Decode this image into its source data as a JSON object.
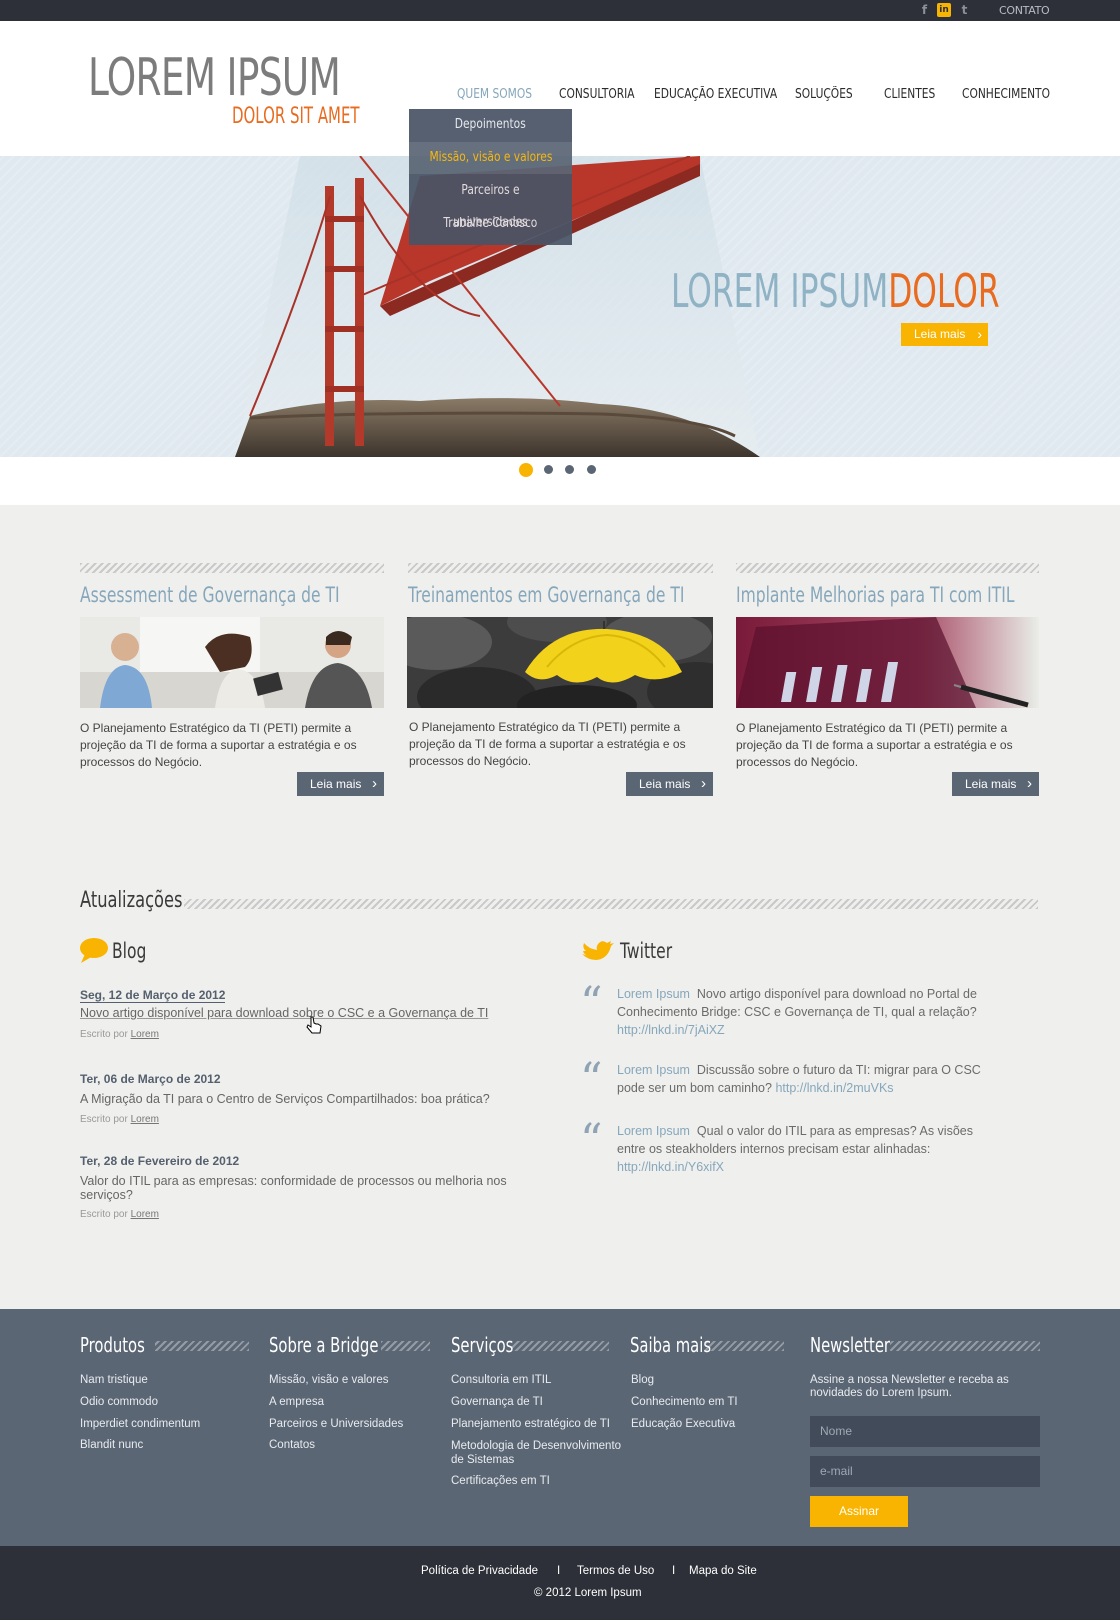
{
  "topbar": {
    "social": [
      {
        "icon": "facebook-icon",
        "glyph": "f"
      },
      {
        "icon": "linkedin-icon",
        "glyph": "in"
      },
      {
        "icon": "twitter-icon",
        "glyph": "t"
      }
    ],
    "contact_label": "CONTATO"
  },
  "logo": {
    "main": "LOREM IPSUM",
    "sub": "DOLOR SIT AMET"
  },
  "nav": {
    "items": [
      "QUEM SOMOS",
      "CONSULTORIA",
      "EDUCAÇÃO EXECUTIVA",
      "SOLUÇÕES",
      "CLIENTES",
      "CONHECIMENTO"
    ],
    "active_index": 0,
    "dropdown": [
      "Depoimentos",
      "Missão, visão e valores",
      "Parceiros e universidades",
      "Trabalhe Conosco"
    ],
    "dropdown_highlight_index": 1
  },
  "hero": {
    "title_part1": "LOREM IPSUM",
    "title_part2": "DOLOR",
    "button_label": "Leia mais",
    "slides": 4,
    "active_slide": 0
  },
  "features": [
    {
      "title": "Assessment de Governança de TI",
      "image": "business-meeting-photo",
      "text": "O Planejamento Estratégico da TI (PETI) permite a projeção da TI de forma a suportar a estratégia e os processos do Negócio.",
      "button": "Leia mais"
    },
    {
      "title": "Treinamentos em Governança de TI",
      "image": "yellow-umbrella-photo",
      "text": "O Planejamento Estratégico da TI (PETI) permite a projeção da TI de forma a suportar a estratégia e os processos do Negócio.",
      "button": "Leia mais"
    },
    {
      "title": "Implante Melhorias para TI com ITIL",
      "image": "financial-chart-photo",
      "text": "O Planejamento Estratégico da TI (PETI) permite a projeção da TI de forma a suportar a estratégia e os processos do Negócio.",
      "button": "Leia mais"
    }
  ],
  "updates": {
    "title": "Atualizações",
    "blog": {
      "title": "Blog",
      "entries": [
        {
          "date": "Seg, 12 de Março de 2012",
          "text": "Novo artigo disponível para download sobre o CSC e a Governança de TI",
          "meta_prefix": "Escrito por",
          "author": "Lorem"
        },
        {
          "date": "Ter, 06 de Março de 2012",
          "text": "A Migração da TI para o Centro de Serviços Compartilhados: boa prática?",
          "meta_prefix": "Escrito por",
          "author": "Lorem"
        },
        {
          "date": "Ter, 28 de Fevereiro de 2012",
          "text": "Valor do ITIL para as empresas: conformidade de processos ou melhoria nos serviços?",
          "meta_prefix": "Escrito por",
          "author": "Lorem"
        }
      ]
    },
    "twitter": {
      "title": "Twitter",
      "tweets": [
        {
          "user": "Lorem Ipsum",
          "text": "Novo artigo disponível para download no Portal de Conhecimento Bridge: CSC e Governança de TI, qual a relação?",
          "link": "http://lnkd.in/7jAiXZ"
        },
        {
          "user": "Lorem Ipsum",
          "text": "Discussão sobre o futuro da TI: migrar para O CSC pode ser um bom caminho?",
          "link": "http://lnkd.in/2muVKs"
        },
        {
          "user": "Lorem Ipsum",
          "text": "Qual o valor do ITIL para as empresas? As visões entre os steakholders internos precisam estar alinhadas:",
          "link": "http://lnkd.in/Y6xifX"
        }
      ]
    }
  },
  "footer": {
    "columns": [
      {
        "title": "Produtos",
        "links": [
          "Nam tristique",
          "Odio commodo",
          "Imperdiet condimentum",
          "Blandit nunc"
        ]
      },
      {
        "title": "Sobre a Bridge",
        "links": [
          "Missão, visão e valores",
          "A empresa",
          "Parceiros e Universidades",
          "Contatos"
        ]
      },
      {
        "title": "Serviços",
        "links": [
          "Consultoria em ITIL",
          "Governança de TI",
          "Planejamento estratégico de TI",
          "Metodologia de Desenvolvimento de Sistemas",
          "Certificações em TI"
        ]
      },
      {
        "title": "Saiba mais",
        "links": [
          "Blog",
          "Conhecimento em TI",
          "Educação Executiva"
        ]
      }
    ],
    "newsletter": {
      "title": "Newsletter",
      "text": "Assine a nossa Newsletter e receba as novidades do Lorem Ipsum.",
      "name_placeholder": "Nome",
      "email_placeholder": "e-mail",
      "submit": "Assinar"
    },
    "bottom_links": [
      "Política de Privacidade",
      "Termos de Uso",
      "Mapa do Site"
    ],
    "separator": "I",
    "copyright": "© 2012 Lorem Ipsum"
  },
  "colors": {
    "accent": "#f8b400",
    "brand_orange": "#e86b1f",
    "slate": "#5b6675",
    "light_blue": "#86a7bb",
    "dark": "#2d3038"
  }
}
